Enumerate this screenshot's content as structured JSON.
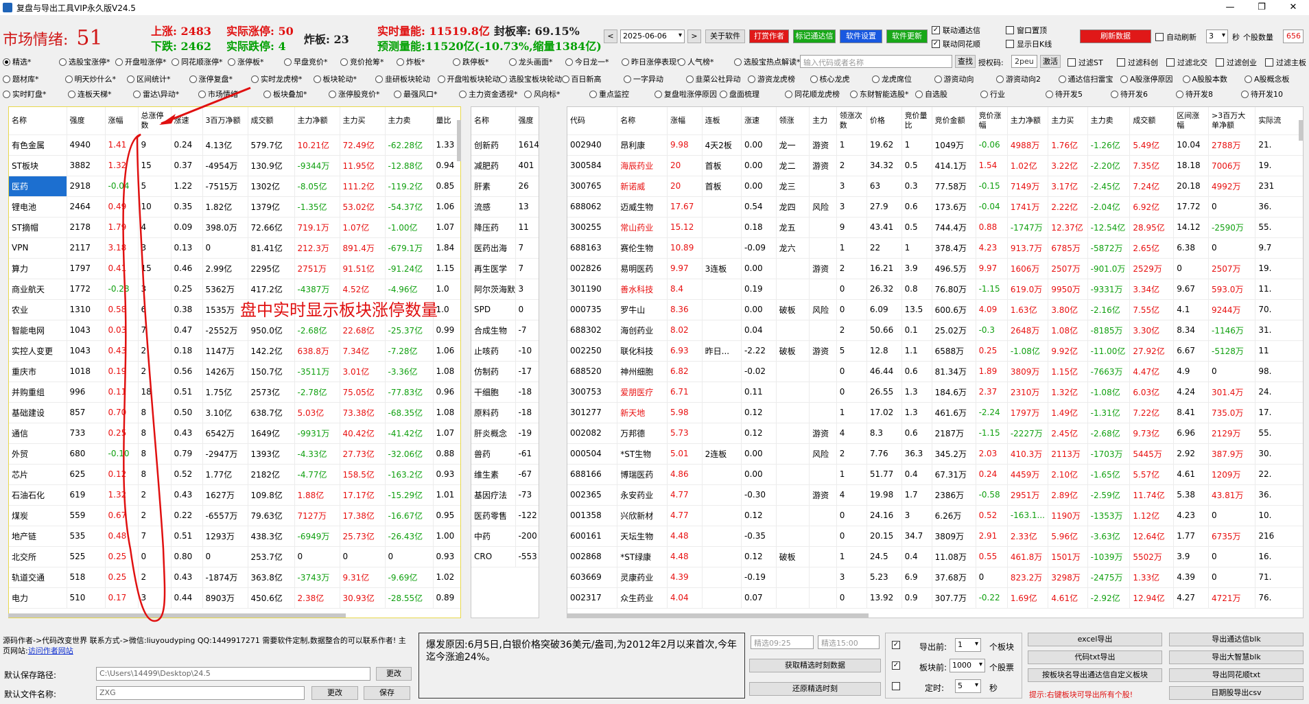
{
  "title": "复盘与导出工具VIP永久版V24.5",
  "win": {
    "min": "—",
    "max": "❐",
    "close": "✕"
  },
  "mood": {
    "label": "市场情绪:",
    "value": "51"
  },
  "stats": {
    "up_label": "上涨:",
    "up": "2483",
    "limit_up_label": "实际涨停:",
    "limit_up": "50",
    "down_label": "下跌:",
    "down": "2462",
    "limit_down_label": "实际跌停:",
    "limit_down": "4",
    "broken_label": "炸板:",
    "broken": "23",
    "volume_label": "实时量能:",
    "volume": "11519.8亿",
    "seal_label": "封板率:",
    "seal": "69.15%",
    "forecast_label": "预测量能:",
    "forecast": "11520亿(-10.73%,缩量1384亿)"
  },
  "toolbar": {
    "prev": "<",
    "date": "2025-06-06",
    "next": ">",
    "about": "关于软件",
    "donate": "打赏作者",
    "tdx": "标记通达信",
    "settings": "软件设置",
    "update": "软件更新",
    "link_tdx": "联动通达信",
    "link_ths": "联动同花顺",
    "pin": "窗口置顶",
    "show_k": "显示日K线",
    "refresh": "刷新数据",
    "auto_refresh": "自动刷新",
    "interval": "3",
    "sec": "秒",
    "count_label": "个股数量",
    "count": "656"
  },
  "radios1": [
    "精选*",
    "选股宝涨停*",
    "开盘啦涨停*",
    "同花顺涨停*",
    "涨停板*",
    "早盘竞价*",
    "竞价抢筹*",
    "炸板*",
    "跌停板*",
    "龙头画面*",
    "今日龙一*",
    "昨日涨停表现*",
    "人气榜*",
    "选股宝热点解读*"
  ],
  "search": {
    "placeholder": "输入代码或者名称",
    "btn": "查找",
    "auth_label": "授权码:",
    "auth": "2peu",
    "activate": "激活"
  },
  "filters": [
    "过滤ST",
    "过滤科创",
    "过滤北交",
    "过滤创业",
    "过滤主板"
  ],
  "radios2": [
    "题材库*",
    "明天炒什么*",
    "区间统计*",
    "涨停复盘*",
    "实时龙虎榜*",
    "板块轮动*",
    "韭研板块轮动",
    "开盘啦板块轮动",
    "选股宝板块轮动",
    "百日新高",
    "一字异动",
    "韭菜公社异动",
    "游资龙虎榜",
    "核心龙虎",
    "龙虎席位",
    "游资动向",
    "游资动向2",
    "通达信扫雷宝",
    "A股涨停原因",
    "A股股本数",
    "A股概念板"
  ],
  "radios3": [
    "实时盯盘*",
    "连板天梯*",
    "雷达\\异动*",
    "市场情绪",
    "板块叠加*",
    "涨停股竞价*",
    "最强风口*",
    "主力资金透视*",
    "风向标*",
    "重点监控",
    "复盘啦涨停原因",
    "盘面梳理",
    "同花顺龙虎榜",
    "东财智能选股*",
    "自选股",
    "行业",
    "待开发5",
    "待开发6",
    "待开发8",
    "待开发10"
  ],
  "left_table": {
    "headers": [
      "名称",
      "强度",
      "涨幅",
      "总涨停数",
      "涨速",
      "3百万净额",
      "成交额",
      "主力净额",
      "主力买",
      "主力卖",
      "量比"
    ],
    "rows": [
      [
        "有色金属",
        "4940",
        "1.41",
        "9",
        "0.24",
        "4.13亿",
        "579.7亿",
        "10.21亿",
        "72.49亿",
        "-62.28亿",
        "1.33"
      ],
      [
        "ST板块",
        "3882",
        "1.32",
        "15",
        "0.37",
        "-4954万",
        "130.9亿",
        "-9344万",
        "11.95亿",
        "-12.88亿",
        "0.94"
      ],
      [
        "医药",
        "2918",
        "-0.04",
        "5",
        "1.22",
        "-7515万",
        "1302亿",
        "-8.05亿",
        "111.2亿",
        "-119.2亿",
        "0.85"
      ],
      [
        "锂电池",
        "2464",
        "0.49",
        "10",
        "0.35",
        "1.82亿",
        "1379亿",
        "-1.35亿",
        "53.02亿",
        "-54.37亿",
        "1.06"
      ],
      [
        "ST摘帽",
        "2178",
        "1.79",
        "4",
        "0.09",
        "398.0万",
        "72.66亿",
        "719.1万",
        "1.07亿",
        "-1.00亿",
        "1.07"
      ],
      [
        "VPN",
        "2117",
        "3.18",
        "3",
        "0.13",
        "0",
        "81.41亿",
        "212.3万",
        "891.4万",
        "-679.1万",
        "1.84"
      ],
      [
        "算力",
        "1797",
        "0.41",
        "15",
        "0.46",
        "2.99亿",
        "2295亿",
        "2751万",
        "91.51亿",
        "-91.24亿",
        "1.15"
      ],
      [
        "商业航天",
        "1772",
        "-0.28",
        "3",
        "0.25",
        "5362万",
        "417.2亿",
        "-4387万",
        "4.52亿",
        "-4.96亿",
        "1.0"
      ],
      [
        "农业",
        "1310",
        "0.58",
        "6",
        "0.38",
        "1535万",
        "",
        "",
        "",
        "",
        "1.0"
      ],
      [
        "智能电网",
        "1043",
        "0.03",
        "7",
        "0.47",
        "-2552万",
        "950.0亿",
        "-2.68亿",
        "22.68亿",
        "-25.37亿",
        "0.99"
      ],
      [
        "实控人变更",
        "1043",
        "0.43",
        "2",
        "0.18",
        "1147万",
        "142.2亿",
        "638.8万",
        "7.34亿",
        "-7.28亿",
        "1.06"
      ],
      [
        "重庆市",
        "1018",
        "0.19",
        "2",
        "0.56",
        "1426万",
        "150.7亿",
        "-3511万",
        "3.01亿",
        "-3.36亿",
        "1.08"
      ],
      [
        "并购重组",
        "996",
        "0.11",
        "18",
        "0.51",
        "1.75亿",
        "2573亿",
        "-2.78亿",
        "75.05亿",
        "-77.83亿",
        "0.96"
      ],
      [
        "基础建设",
        "857",
        "0.70",
        "8",
        "0.50",
        "3.10亿",
        "638.7亿",
        "5.03亿",
        "73.38亿",
        "-68.35亿",
        "1.08"
      ],
      [
        "通信",
        "733",
        "0.25",
        "8",
        "0.43",
        "6542万",
        "1649亿",
        "-9931万",
        "40.42亿",
        "-41.42亿",
        "1.07"
      ],
      [
        "外贸",
        "680",
        "-0.10",
        "8",
        "0.79",
        "-2947万",
        "1393亿",
        "-4.33亿",
        "27.73亿",
        "-32.06亿",
        "0.88"
      ],
      [
        "芯片",
        "625",
        "0.12",
        "8",
        "0.52",
        "1.77亿",
        "2182亿",
        "-4.77亿",
        "158.5亿",
        "-163.2亿",
        "0.93"
      ],
      [
        "石油石化",
        "619",
        "1.32",
        "2",
        "0.43",
        "1627万",
        "109.8亿",
        "1.88亿",
        "17.17亿",
        "-15.29亿",
        "1.01"
      ],
      [
        "煤炭",
        "559",
        "0.67",
        "2",
        "0.22",
        "-6557万",
        "79.63亿",
        "7127万",
        "17.38亿",
        "-16.67亿",
        "0.95"
      ],
      [
        "地产链",
        "535",
        "0.48",
        "7",
        "0.51",
        "1293万",
        "438.3亿",
        "-6949万",
        "25.73亿",
        "-26.43亿",
        "1.00"
      ],
      [
        "北交所",
        "525",
        "0.25",
        "0",
        "0.80",
        "0",
        "253.7亿",
        "0",
        "0",
        "0",
        "0.93"
      ],
      [
        "轨道交通",
        "518",
        "0.25",
        "2",
        "0.43",
        "-1874万",
        "363.8亿",
        "-3743万",
        "9.31亿",
        "-9.69亿",
        "1.02"
      ],
      [
        "电力",
        "510",
        "0.17",
        "3",
        "0.44",
        "8903万",
        "450.6亿",
        "2.38亿",
        "30.93亿",
        "-28.55亿",
        "0.89"
      ]
    ]
  },
  "annotation": "盘中实时显示板块涨停数量",
  "mid_table": {
    "headers": [
      "名称",
      "强度"
    ],
    "rows": [
      [
        "创新药",
        "1614"
      ],
      [
        "减肥药",
        "401"
      ],
      [
        "肝素",
        "26"
      ],
      [
        "流感",
        "13"
      ],
      [
        "降压药",
        "11"
      ],
      [
        "医药出海",
        "7"
      ],
      [
        "再生医学",
        "7"
      ],
      [
        "阿尔茨海默",
        "3"
      ],
      [
        "SPD",
        "0"
      ],
      [
        "合成生物",
        "-7"
      ],
      [
        "止咳药",
        "-10"
      ],
      [
        "仿制药",
        "-17"
      ],
      [
        "干细胞",
        "-18"
      ],
      [
        "原料药",
        "-18"
      ],
      [
        "肝炎概念",
        "-19"
      ],
      [
        "兽药",
        "-61"
      ],
      [
        "维生素",
        "-67"
      ],
      [
        "基因疗法",
        "-73"
      ],
      [
        "医药零售",
        "-122"
      ],
      [
        "中药",
        "-200"
      ],
      [
        "CRO",
        "-553"
      ]
    ]
  },
  "right_table": {
    "headers": [
      "代码",
      "名称",
      "涨幅",
      "连板",
      "涨速",
      "领涨",
      "主力",
      "领涨次数",
      "价格",
      "竞价量比",
      "竞价金额",
      "竞价涨幅",
      "主力净额",
      "主力买",
      "主力卖",
      "成交额",
      "区间涨幅",
      ">3百万大单净额",
      "实际流"
    ],
    "rows": [
      [
        "002940",
        "昂利康",
        "9.98",
        "4天2板",
        "0.00",
        "龙一",
        "游资",
        "1",
        "19.62",
        "1",
        "1049万",
        "-0.06",
        "4988万",
        "1.76亿",
        "-1.26亿",
        "5.49亿",
        "10.04",
        "2788万",
        "21."
      ],
      [
        "300584",
        "海辰药业",
        "20",
        "首板",
        "0.00",
        "龙二",
        "游资",
        "2",
        "34.32",
        "0.5",
        "414.1万",
        "1.54",
        "1.02亿",
        "3.22亿",
        "-2.20亿",
        "7.35亿",
        "18.18",
        "7006万",
        "19."
      ],
      [
        "300765",
        "新诺威",
        "20",
        "首板",
        "0.00",
        "龙三",
        "",
        "3",
        "63",
        "0.3",
        "77.58万",
        "-0.15",
        "7149万",
        "3.17亿",
        "-2.45亿",
        "7.24亿",
        "20.18",
        "4992万",
        "231"
      ],
      [
        "688062",
        "迈威生物",
        "17.67",
        "",
        "0.54",
        "龙四",
        "风险",
        "3",
        "27.9",
        "0.6",
        "173.6万",
        "-0.04",
        "1741万",
        "2.22亿",
        "-2.04亿",
        "6.92亿",
        "17.72",
        "0",
        "36."
      ],
      [
        "300255",
        "常山药业",
        "15.12",
        "",
        "0.18",
        "龙五",
        "",
        "9",
        "43.41",
        "0.5",
        "744.4万",
        "0.88",
        "-1747万",
        "12.37亿",
        "-12.54亿",
        "28.95亿",
        "14.12",
        "-2590万",
        "55."
      ],
      [
        "688163",
        "赛伦生物",
        "10.89",
        "",
        "-0.09",
        "龙六",
        "",
        "1",
        "22",
        "1",
        "378.4万",
        "4.23",
        "913.7万",
        "6785万",
        "-5872万",
        "2.65亿",
        "6.38",
        "0",
        "9.7"
      ],
      [
        "002826",
        "易明医药",
        "9.97",
        "3连板",
        "0.00",
        "",
        "游资",
        "2",
        "16.21",
        "3.9",
        "496.5万",
        "9.97",
        "1606万",
        "2507万",
        "-901.0万",
        "2529万",
        "0",
        "2507万",
        "19."
      ],
      [
        "301190",
        "善水科技",
        "8.4",
        "",
        "0.19",
        "",
        "",
        "0",
        "26.32",
        "0.8",
        "76.80万",
        "-1.15",
        "619.0万",
        "9950万",
        "-9331万",
        "3.34亿",
        "9.67",
        "593.0万",
        "11."
      ],
      [
        "000735",
        "罗牛山",
        "8.36",
        "",
        "0.00",
        "破板",
        "风险",
        "0",
        "6.09",
        "13.5",
        "600.6万",
        "4.09",
        "1.63亿",
        "3.80亿",
        "-2.16亿",
        "7.55亿",
        "4.1",
        "9244万",
        "70."
      ],
      [
        "688302",
        "海创药业",
        "8.02",
        "",
        "0.04",
        "",
        "",
        "2",
        "50.66",
        "0.1",
        "25.02万",
        "-0.3",
        "2648万",
        "1.08亿",
        "-8185万",
        "3.30亿",
        "8.34",
        "-1146万",
        "31."
      ],
      [
        "002250",
        "联化科技",
        "6.93",
        "昨日...",
        "-2.22",
        "破板",
        "游资",
        "5",
        "12.8",
        "1.1",
        "6588万",
        "0.25",
        "-1.08亿",
        "9.92亿",
        "-11.00亿",
        "27.92亿",
        "6.67",
        "-5128万",
        "11"
      ],
      [
        "688520",
        "神州细胞",
        "6.82",
        "",
        "-0.02",
        "",
        "",
        "0",
        "46.44",
        "0.6",
        "81.34万",
        "1.89",
        "3809万",
        "1.15亿",
        "-7663万",
        "4.47亿",
        "4.9",
        "0",
        "98."
      ],
      [
        "300753",
        "爱朋医疗",
        "6.71",
        "",
        "0.11",
        "",
        "",
        "0",
        "26.55",
        "1.3",
        "184.6万",
        "2.37",
        "2310万",
        "1.32亿",
        "-1.08亿",
        "6.03亿",
        "4.24",
        "301.4万",
        "24."
      ],
      [
        "301277",
        "新天地",
        "5.98",
        "",
        "0.12",
        "",
        "",
        "1",
        "17.02",
        "1.3",
        "461.6万",
        "-2.24",
        "1797万",
        "1.49亿",
        "-1.31亿",
        "7.22亿",
        "8.41",
        "735.0万",
        "17."
      ],
      [
        "002082",
        "万邦德",
        "5.73",
        "",
        "0.12",
        "",
        "游资",
        "4",
        "8.3",
        "0.6",
        "2187万",
        "-1.15",
        "-2227万",
        "2.45亿",
        "-2.68亿",
        "9.73亿",
        "6.96",
        "2129万",
        "55."
      ],
      [
        "000504",
        "*ST生物",
        "5.01",
        "2连板",
        "0.00",
        "",
        "风险",
        "2",
        "7.76",
        "36.3",
        "345.2万",
        "2.03",
        "410.3万",
        "2113万",
        "-1703万",
        "5445万",
        "2.92",
        "387.9万",
        "30."
      ],
      [
        "688166",
        "博瑞医药",
        "4.86",
        "",
        "0.00",
        "",
        "",
        "1",
        "51.77",
        "0.4",
        "67.31万",
        "0.24",
        "4459万",
        "2.10亿",
        "-1.65亿",
        "5.57亿",
        "4.61",
        "1209万",
        "22."
      ],
      [
        "002365",
        "永安药业",
        "4.77",
        "",
        "-0.30",
        "",
        "游资",
        "4",
        "19.98",
        "1.7",
        "2386万",
        "-0.58",
        "2951万",
        "2.89亿",
        "-2.59亿",
        "11.74亿",
        "5.38",
        "43.81万",
        "36."
      ],
      [
        "001358",
        "兴欣新材",
        "4.77",
        "",
        "0.12",
        "",
        "",
        "0",
        "24.16",
        "3",
        "6.26万",
        "0.52",
        "-163.1...",
        "1190万",
        "-1353万",
        "1.12亿",
        "4.23",
        "0",
        "10."
      ],
      [
        "600161",
        "天坛生物",
        "4.48",
        "",
        "-0.35",
        "",
        "",
        "0",
        "20.15",
        "34.7",
        "3809万",
        "2.91",
        "2.33亿",
        "5.96亿",
        "-3.63亿",
        "12.64亿",
        "1.77",
        "6735万",
        "216"
      ],
      [
        "002868",
        "*ST绿康",
        "4.48",
        "",
        "0.12",
        "破板",
        "",
        "1",
        "24.5",
        "0.4",
        "11.08万",
        "0.55",
        "461.8万",
        "1501万",
        "-1039万",
        "5502万",
        "3.9",
        "0",
        "16."
      ],
      [
        "603669",
        "灵康药业",
        "4.39",
        "",
        "-0.19",
        "",
        "",
        "3",
        "5.23",
        "6.9",
        "37.68万",
        "0",
        "823.2万",
        "3298万",
        "-2475万",
        "1.33亿",
        "4.39",
        "0",
        "71."
      ],
      [
        "002317",
        "众生药业",
        "4.04",
        "",
        "0.07",
        "",
        "",
        "0",
        "13.92",
        "0.9",
        "307.7万",
        "-0.22",
        "1.69亿",
        "4.61亿",
        "-2.92亿",
        "12.94亿",
        "4.27",
        "4721万",
        "76."
      ]
    ]
  },
  "bottom": {
    "author_line1": "源码作者->代码改变世界 联系方式->微信:liuyoudyping QQ:1449917271 需要软件定制,数据整合的可以联系作者!",
    "author_line2_label": "主页网站:",
    "author_link": "访问作者网站",
    "path_label": "默认保存路径:",
    "path": "C:\\Users\\14499\\Desktop\\24.5",
    "change": "更改",
    "file_label": "默认文件名称:",
    "file": "ZXG",
    "save": "保存",
    "reason": "爆发原因:6月5日,白银价格突破36美元/盎司,为2012年2月以来首次,今年迄今涨逾24%。",
    "sel_time1": "精选09:25",
    "sel_time2": "精选15:00",
    "get_snapshot": "获取精选时刻数据",
    "restore": "还原精选时刻",
    "export_before_label": "导出前:",
    "export_before": "1",
    "block_unit": "个板块",
    "block_before_label": "板块前:",
    "block_before": "1000",
    "stock_unit": "个股票",
    "timer_label": "定时:",
    "timer": "5",
    "sec": "秒",
    "excel": "excel导出",
    "tdx_blk": "导出通达信blk",
    "txt": "代码txt导出",
    "dzh_blk": "导出大智慧blk",
    "custom": "按板块名导出通达信自定义板块",
    "ths_txt": "导出同花顺txt",
    "tip": "提示:右键板块可导出所有个股!",
    "csv": "日期股导出csv"
  },
  "colors": {
    "red": "#e81010",
    "green": "#10a010",
    "accent": "#1c6fd0"
  }
}
